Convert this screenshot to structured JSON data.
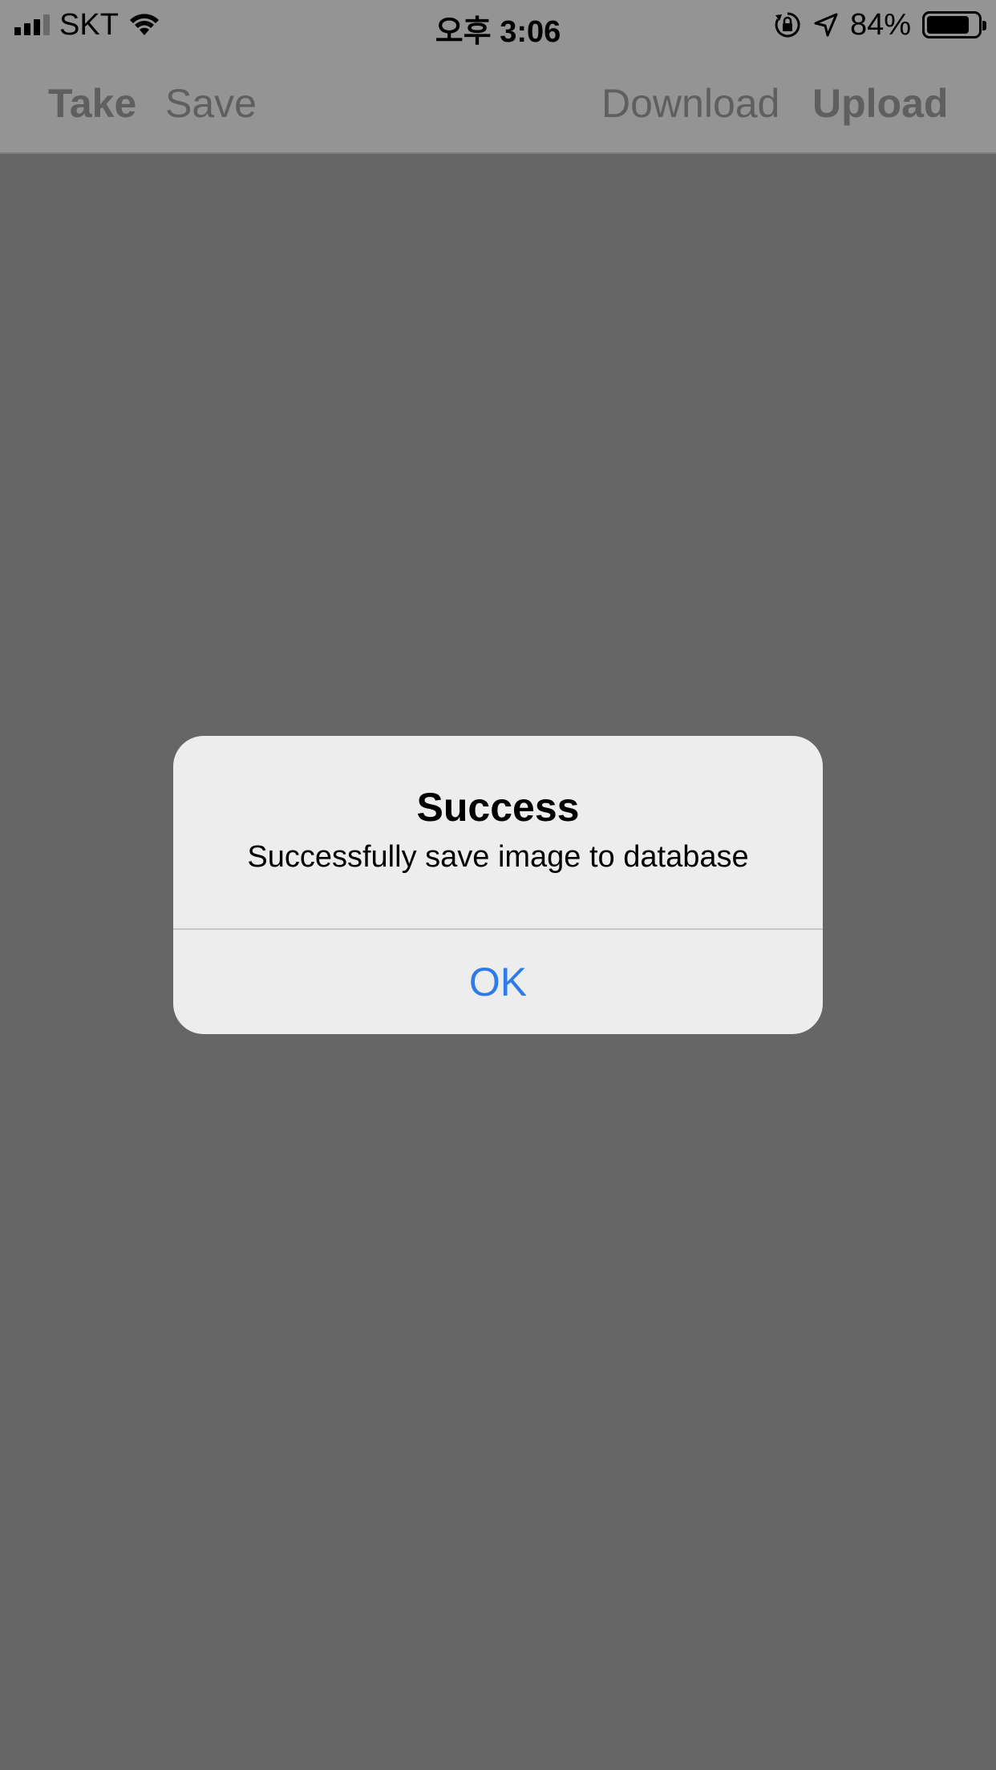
{
  "status_bar": {
    "carrier": "SKT",
    "time": "오후 3:06",
    "battery_percent": "84%",
    "battery_level": 0.84,
    "icons": [
      "signal-icon",
      "wifi-icon",
      "rotation-lock-icon",
      "location-arrow-icon",
      "battery-icon"
    ]
  },
  "toolbar": {
    "take_label": "Take",
    "save_label": "Save",
    "download_label": "Download",
    "upload_label": "Upload"
  },
  "alert": {
    "title": "Success",
    "message": "Successfully save image to database",
    "ok_label": "OK",
    "accent_color": "#2f7bea"
  }
}
